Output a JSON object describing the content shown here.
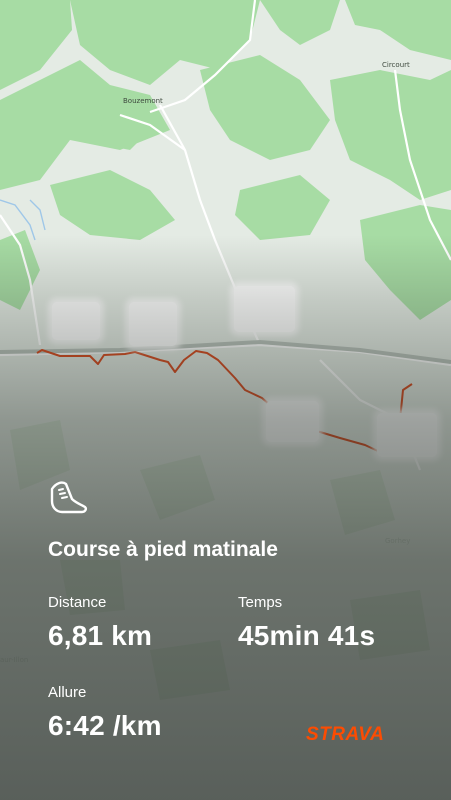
{
  "map": {
    "place_names": [
      "Bouzemont",
      "Circourt",
      "Gorhey",
      "aur-Illon"
    ]
  },
  "activity": {
    "icon": "running-shoe-icon",
    "title": "Course à pied matinale",
    "stats": [
      {
        "label": "Distance",
        "value": "6,81 km"
      },
      {
        "label": "Temps",
        "value": "45min 41s"
      },
      {
        "label": "Allure",
        "value": "6:42 /km"
      }
    ]
  },
  "brand": {
    "name": "STRAVA",
    "color": "#fc4c02"
  },
  "colors": {
    "route": "#d9481c",
    "text": "#ffffff",
    "forest": "#a6dca3",
    "land": "#e6ede6"
  }
}
